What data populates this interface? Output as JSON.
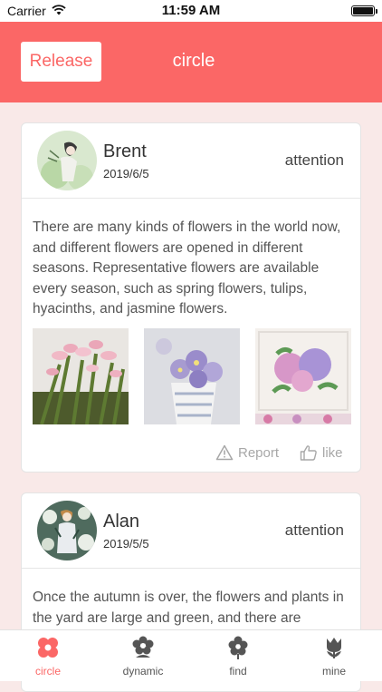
{
  "status_bar": {
    "carrier": "Carrier",
    "time": "11:59 AM"
  },
  "header": {
    "release_label": "Release",
    "title": "circle"
  },
  "posts": [
    {
      "name": "Brent",
      "date": "2019/6/5",
      "attention_label": "attention",
      "text": "There are many kinds of flowers in the world now, and different flowers are opened in different seasons. Representative flowers are available every season, such as spring flowers, tulips, hyacinths, and jasmine flowers.",
      "report_label": "Report",
      "like_label": "like"
    },
    {
      "name": "Alan",
      "date": "2019/5/5",
      "attention_label": "attention",
      "text": "Once the autumn is over, the flowers and plants in the yard are large and green, and there are"
    }
  ],
  "tabs": [
    {
      "label": "circle",
      "icon": "flower-icon",
      "active": true
    },
    {
      "label": "dynamic",
      "icon": "gear-flower-icon",
      "active": false
    },
    {
      "label": "find",
      "icon": "bloom-icon",
      "active": false
    },
    {
      "label": "mine",
      "icon": "tulip-icon",
      "active": false
    }
  ],
  "colors": {
    "accent": "#fb6766",
    "background": "#f9e9e8",
    "tab_inactive": "#555555"
  }
}
